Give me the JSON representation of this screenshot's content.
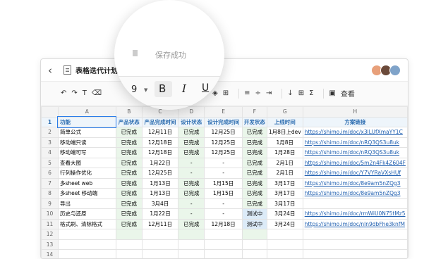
{
  "titlebar": {
    "title": "表格迭代计划"
  },
  "toast": {
    "saved": "保存成功"
  },
  "toolbar": {
    "font_size": "9",
    "bold": "B",
    "italic": "I",
    "underline": "U",
    "view": "查看"
  },
  "columns": [
    "A",
    "B",
    "C",
    "D",
    "E",
    "F",
    "G",
    "H"
  ],
  "rows": [
    [
      "1",
      "功能",
      "产品状态",
      "产品完成时间",
      "设计状态",
      "设计完成时间",
      "开发状态",
      "上线时间",
      "方案链接"
    ],
    [
      "2",
      "简单公式",
      "已完成",
      "12月11日",
      "已完成",
      "12月25日",
      "已完成",
      "1月8日上dev",
      "https://shimo.im/doc/x3lLUfXmaYY1C"
    ],
    [
      "3",
      "移动端只读",
      "已完成",
      "12月18日",
      "已完成",
      "12月25日",
      "已完成",
      "1月8日",
      "https://shimo.im/doc/nRQ3QS3u8uk"
    ],
    [
      "4",
      "移动端可写",
      "已完成",
      "12月18日",
      "已完成",
      "12月25日",
      "已完成",
      "1月28日",
      "https://shimo.im/doc/nRQ3QS3u8uk"
    ],
    [
      "5",
      "查看大图",
      "已完成",
      "1月22日",
      "-",
      "-",
      "已完成",
      "2月1日",
      "https://shimo.im/doc/5m2n4Fk4Z604F"
    ],
    [
      "6",
      "行列操作优化",
      "已完成",
      "12月25日",
      "-",
      "-",
      "已完成",
      "2月1日",
      "https://shimo.im/doc/Y7VYRaVXsHUf"
    ],
    [
      "7",
      "多sheet web",
      "已完成",
      "1月13日",
      "已完成",
      "1月15日",
      "已完成",
      "3月17日",
      "https://shimo.im/doc/8e9am5nZQg3"
    ],
    [
      "8",
      "多sheet 移动端",
      "已完成",
      "1月13日",
      "已完成",
      "1月15日",
      "已完成",
      "3月17日",
      "https://shimo.im/doc/8e9am5nZQg3"
    ],
    [
      "9",
      "导出",
      "已完成",
      "3月4日",
      "-",
      "-",
      "已完成",
      "3月17日",
      ""
    ],
    [
      "10",
      "历史与还原",
      "已完成",
      "1月22日",
      "-",
      "-",
      "测试中",
      "3月24日",
      "https://shimo.im/doc/rmWiU0N75tMz5"
    ],
    [
      "11",
      "格式刷、清除格式",
      "已完成",
      "12月11日",
      "已完成",
      "12月18日",
      "测试中",
      "3月24日",
      "https://shimo.im/doc/nln9dbFhe3knfM"
    ],
    [
      "12",
      "",
      "",
      "",
      "",
      "",
      "",
      "",
      ""
    ],
    [
      "13",
      "",
      "",
      "",
      "",
      "",
      "",
      "",
      ""
    ],
    [
      "14",
      "",
      "",
      "",
      "",
      "",
      "",
      "",
      ""
    ],
    [
      "15",
      "",
      "",
      "",
      "",
      "",
      "",
      "",
      ""
    ]
  ]
}
